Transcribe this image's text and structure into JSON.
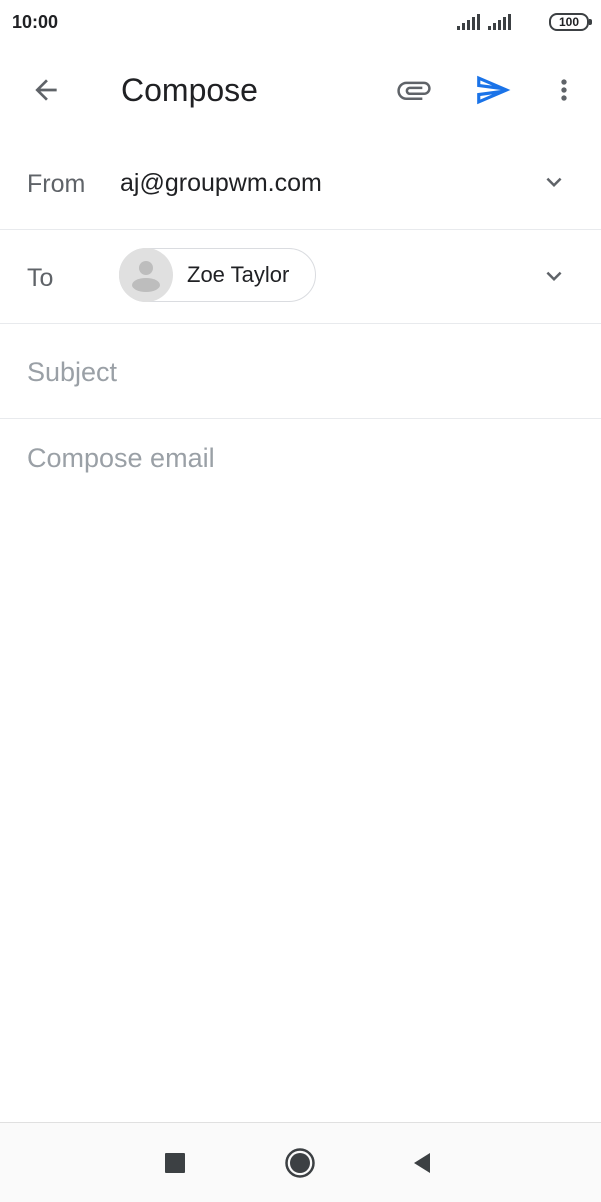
{
  "status_bar": {
    "time": "10:00",
    "battery": "100",
    "icons": [
      "signal-icon",
      "signal-icon",
      "battery-icon"
    ]
  },
  "app_bar": {
    "title": "Compose",
    "icons": [
      "back-arrow-icon",
      "paperclip-icon",
      "send-icon",
      "more-vert-icon"
    ],
    "accent_color": "#1a73e8"
  },
  "from": {
    "label": "From",
    "value": "aj@groupwm.com"
  },
  "to": {
    "label": "To",
    "recipients": [
      {
        "name": "Zoe Taylor"
      }
    ]
  },
  "subject": {
    "placeholder": "Subject",
    "value": ""
  },
  "body": {
    "placeholder": "Compose email",
    "value": ""
  },
  "nav_bar": {
    "icons": [
      "square-recents-icon",
      "circle-home-icon",
      "triangle-back-icon"
    ]
  }
}
